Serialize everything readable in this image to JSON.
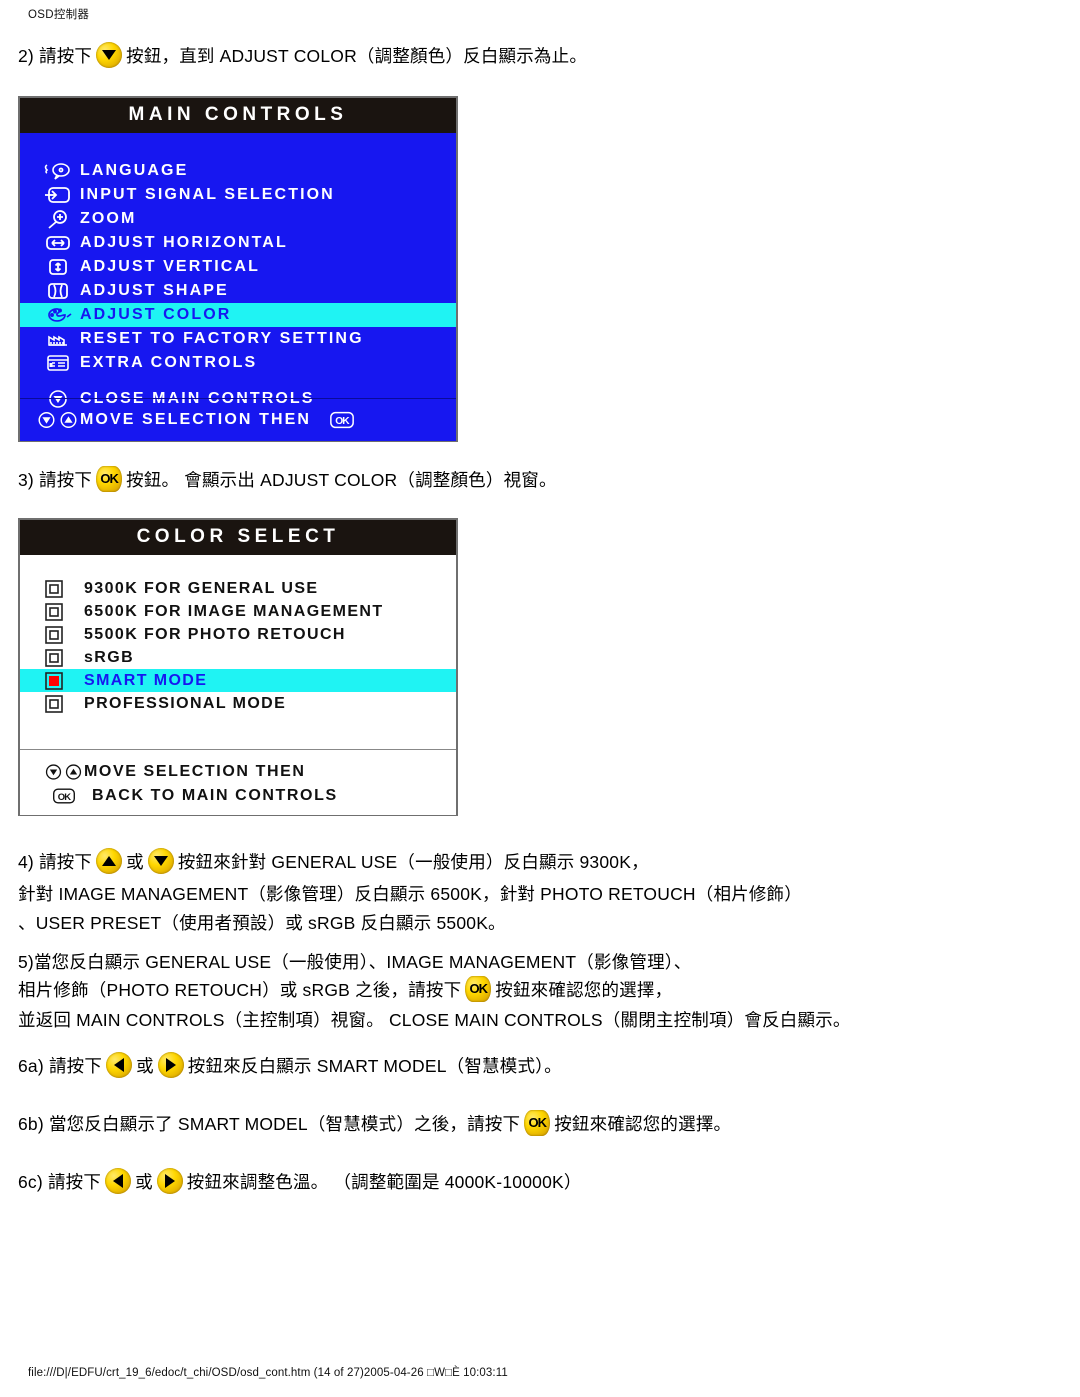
{
  "page": {
    "header": "OSD控制器",
    "footer": "file:///D|/EDFU/crt_19_6/edoc/t_chi/OSD/osd_cont.htm (14 of 27)2005-04-26 □W□È   10:03:11"
  },
  "colors": {
    "osd_blue": "#1717F0",
    "osd_highlight_cyan": "#1FF3F3",
    "osd_titlebar": "#1A1410",
    "osd_white_panel": "#FFFFFF",
    "button_yellow": "#FFD700",
    "selected_radio_red": "#FF0000",
    "panel_border": "#6F6F6F"
  },
  "steps": {
    "s2": {
      "prefix": "2) 請按下",
      "button": "down-arrow",
      "suffix": "按鈕，直到 ADJUST COLOR（調整顏色）反白顯示為止。"
    },
    "s3": {
      "prefix": "3) 請按下",
      "button": "ok",
      "suffix": "按鈕。 會顯示出 ADJUST COLOR（調整顏色）視窗。"
    },
    "s4": {
      "line1_prefix": "4) 請按下",
      "button_a": "up-arrow",
      "line1_mid": "或",
      "button_b": "down-arrow",
      "line1_suffix": "按鈕來針對 GENERAL USE（一般使用）反白顯示 9300K，",
      "line2": "針對 IMAGE MANAGEMENT（影像管理）反白顯示 6500K，針對 PHOTO RETOUCH（相片修飾）",
      "line3": "、USER PRESET（使用者預設）或 sRGB 反白顯示 5500K。"
    },
    "s5": {
      "line1": "5)當您反白顯示 GENERAL USE（一般使用）、IMAGE MANAGEMENT（影像管理）、",
      "line2_prefix": "相片修飾（PHOTO RETOUCH）或 sRGB 之後，請按下",
      "button": "ok",
      "line2_suffix": "按鈕來確認您的選擇，",
      "line3": "並返回 MAIN CONTROLS（主控制項）視窗。 CLOSE MAIN CONTROLS（關閉主控制項）會反白顯示。"
    },
    "s6a": {
      "prefix": "6a) 請按下",
      "button_a": "left-arrow",
      "mid": "或",
      "button_b": "right-arrow",
      "suffix": "按鈕來反白顯示 SMART MODEL（智慧模式）。"
    },
    "s6b": {
      "prefix": "6b) 當您反白顯示了 SMART MODEL（智慧模式）之後，請按下",
      "button": "ok",
      "suffix": "按鈕來確認您的選擇。"
    },
    "s6c": {
      "prefix": "6c) 請按下",
      "button_a": "left-arrow",
      "mid": "或",
      "button_b": "right-arrow",
      "suffix": "按鈕來調整色溫。 （調整範圍是 4000K-10000K）"
    }
  },
  "main_controls": {
    "title": "MAIN CONTROLS",
    "items": [
      {
        "label": "LANGUAGE",
        "icon": "speech-language-icon",
        "selected": false
      },
      {
        "label": "INPUT SIGNAL SELECTION",
        "icon": "input-signal-icon",
        "selected": false
      },
      {
        "label": "ZOOM",
        "icon": "magnifier-plus-icon",
        "selected": false
      },
      {
        "label": "ADJUST HORIZONTAL",
        "icon": "horizontal-arrows-icon",
        "selected": false
      },
      {
        "label": "ADJUST VERTICAL",
        "icon": "vertical-arrows-icon",
        "selected": false
      },
      {
        "label": "ADJUST SHAPE",
        "icon": "shape-pincushion-icon",
        "selected": false
      },
      {
        "label": "ADJUST COLOR",
        "icon": "palette-icon",
        "selected": true
      },
      {
        "label": "RESET TO FACTORY SETTING",
        "icon": "factory-icon",
        "selected": false
      },
      {
        "label": "EXTRA CONTROLS",
        "icon": "extra-controls-icon",
        "selected": false
      }
    ],
    "close_item": {
      "label": "CLOSE MAIN CONTROLS",
      "icon": "close-down-icon"
    },
    "footer": {
      "label": "MOVE SELECTION THEN",
      "icons": [
        "down-circle-icon",
        "up-circle-icon"
      ],
      "trailing_icon": "ok-box-icon"
    }
  },
  "color_select": {
    "title": "COLOR SELECT",
    "items": [
      {
        "label": "9300K FOR GENERAL USE",
        "selected": false
      },
      {
        "label": "6500K FOR IMAGE MANAGEMENT",
        "selected": false
      },
      {
        "label": "5500K FOR PHOTO RETOUCH",
        "selected": false
      },
      {
        "label": "sRGB",
        "selected": false
      },
      {
        "label": "SMART MODE",
        "selected": true
      },
      {
        "label": "PROFESSIONAL MODE",
        "selected": false
      }
    ],
    "footer_line1": {
      "label": "MOVE SELECTION THEN",
      "icons": [
        "down-circle-icon",
        "up-circle-icon"
      ]
    },
    "footer_line2": {
      "label": "BACK TO MAIN CONTROLS",
      "icon": "ok-box-icon"
    }
  }
}
